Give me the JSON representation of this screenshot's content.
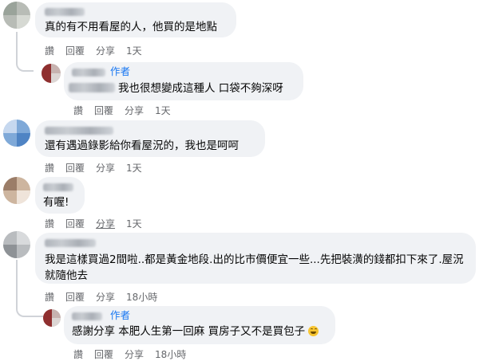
{
  "comments": [
    {
      "text": "真的有不用看屋的人，他買的是地點",
      "actions": {
        "like": "讚",
        "reply": "回覆",
        "share": "分享",
        "time": "1天"
      }
    },
    {
      "author_badge": "作者",
      "text": "我也很想變成這種人 口袋不夠深呀",
      "actions": {
        "like": "讚",
        "reply": "回覆",
        "share": "分享",
        "time": "1天"
      }
    },
    {
      "text": "還有遇過錄影給你看屋況的，我也是呵呵",
      "actions": {
        "like": "讚",
        "reply": "回覆",
        "share": "分享",
        "time": "1天"
      }
    },
    {
      "text": "有喔!",
      "actions": {
        "like": "讚",
        "reply": "回覆",
        "share": "分享",
        "time": "1天"
      }
    },
    {
      "text": "我是這樣買過2間啦..都是黃金地段.出的比市價便宜一些...先把裝潢的錢都扣下來了.屋況就隨他去",
      "actions": {
        "like": "讚",
        "reply": "回覆",
        "share": "分享",
        "time": "18小時"
      }
    },
    {
      "author_badge": "作者",
      "text": "感謝分享 本肥人生第一回麻 買房子又不是買包子",
      "emoji": "grinning-face-icon",
      "actions": {
        "like": "讚",
        "reply": "回覆",
        "share": "分享",
        "time": "18小時"
      }
    }
  ],
  "colors": {
    "bubble": "#f0f2f5",
    "author_badge": "#1877f2",
    "meta_text": "#65676b"
  }
}
